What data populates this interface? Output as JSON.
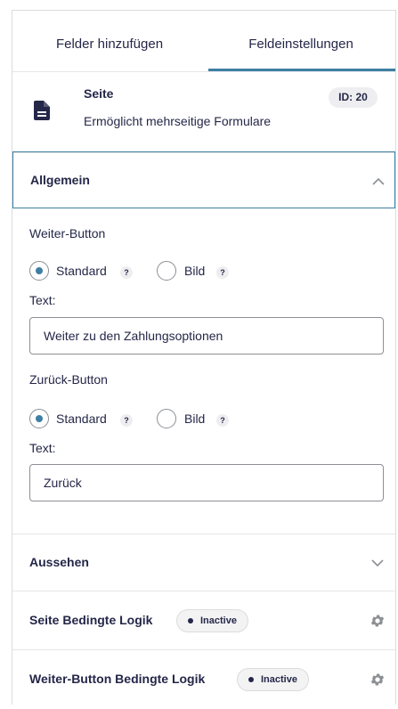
{
  "tabs": [
    {
      "label": "Felder hinzufügen"
    },
    {
      "label": "Feldeinstellungen"
    }
  ],
  "field": {
    "title": "Seite",
    "description": "Ermöglicht mehrseitige Formulare",
    "id_badge": "ID: 20",
    "icon": "document-icon"
  },
  "section": {
    "title": "Allgemein",
    "icon": "chevron-up-icon"
  },
  "next_button": {
    "label": "Weiter-Button",
    "option_standard": "Standard",
    "option_image": "Bild",
    "selected": "Standard",
    "help": "?",
    "text_label": "Text:",
    "text_value": "Weiter zu den Zahlungsoptionen"
  },
  "prev_button": {
    "label": "Zurück-Button",
    "option_standard": "Standard",
    "option_image": "Bild",
    "selected": "Standard",
    "help": "?",
    "text_label": "Text:",
    "text_value": "Zurück"
  },
  "appearance": {
    "title": "Aussehen",
    "icon": "chevron-down-icon"
  },
  "page_logic": {
    "title": "Seite Bedingte Logik",
    "status": "Inactive",
    "icon": "gear-icon"
  },
  "next_logic": {
    "title": "Weiter-Button Bedingte Logik",
    "status": "Inactive",
    "icon": "gear-icon"
  },
  "colors": {
    "accent": "#3e7fa3",
    "text": "#242748",
    "border": "#8c8f94"
  }
}
